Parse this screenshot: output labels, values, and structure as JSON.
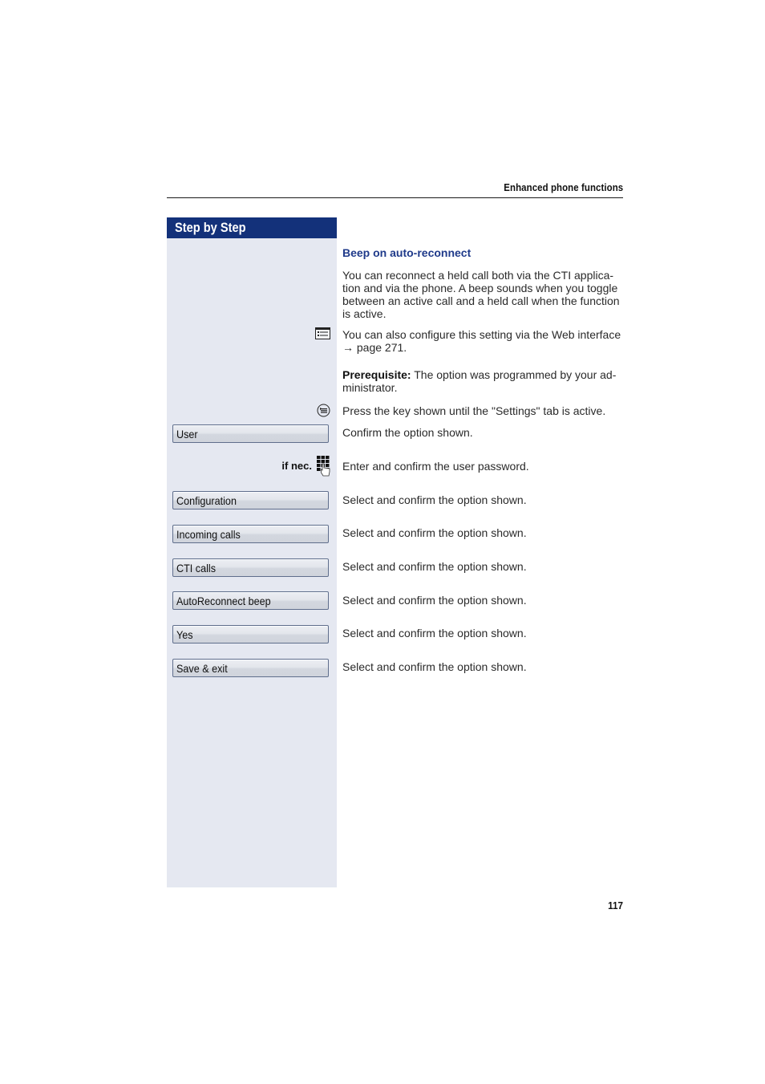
{
  "header": {
    "running_title": "Enhanced phone functions"
  },
  "sidebar": {
    "title": "Step by Step",
    "if_nec_label": "if nec.",
    "icons": {
      "web_interface": "web-interface-icon",
      "menu_key": "menu-key-icon",
      "keypad": "keypad-icon"
    },
    "buttons": [
      {
        "label": "User"
      },
      {
        "label": "Configuration"
      },
      {
        "label": "Incoming calls"
      },
      {
        "label": "CTI calls"
      },
      {
        "label": "AutoReconnect beep"
      },
      {
        "label": "Yes"
      },
      {
        "label": "Save & exit"
      }
    ]
  },
  "main": {
    "section_title": "Beep on auto-reconnect",
    "intro_lines": [
      "You can reconnect a held call both via the CTI applica-",
      "tion and via the phone. A beep sounds when you toggle",
      "between an active call and a held call when the function",
      "is active."
    ],
    "web_note_line1": "You can also configure this setting via the Web interface",
    "web_note_arrow": "→",
    "web_note_line2": "page 271.",
    "prerequisite_label": "Prerequisite:",
    "prerequisite_text_line1": " The option was programmed by your ad-",
    "prerequisite_text_line2": "ministrator.",
    "steps": [
      "Press the key shown until the \"Settings\" tab is active.",
      "Confirm the option shown.",
      "Enter and confirm the user password.",
      "Select and confirm the option shown.",
      "Select and confirm the option shown.",
      "Select and confirm the option shown.",
      "Select and confirm the option shown.",
      "Select and confirm the option shown.",
      "Select and confirm the option shown."
    ]
  },
  "footer": {
    "page_number": "117"
  },
  "colors": {
    "sidebar_header_bg": "#13317a",
    "sidebar_bg": "#e5e8f1",
    "section_title": "#1f3a8a"
  }
}
